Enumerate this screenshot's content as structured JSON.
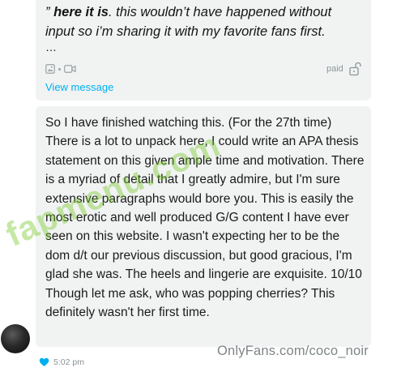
{
  "message_preview": {
    "quote_mark": "”",
    "bold_phrase": "here it is",
    "text": ". this wouldn’t have happened without input so i’m sharing it with my favorite fans first.",
    "ellipsis": "…",
    "media_icons": [
      "image-icon",
      "video-icon"
    ],
    "paid_label": "paid",
    "view_message_label": "View message"
  },
  "reply": {
    "text": "So I have finished watching this. (For the 27th time) There is a lot to unpack here, I could write an APA thesis statement on this given ample time and motivation. There is a myriad of detail that I greatly admire, but I'm sure extensive paragraphs would bore you. This is easily the most erotic and well produced G/G content I have ever seen on this website. I wasn't expecting her to be the dom d/t our previous discussion, but good gracious, I'm glad she was. The heels and lingerie are exquisite. 10/10 Though let me ask, who was popping cherries? This definitely wasn't her first time.",
    "timestamp": "5:02 pm"
  },
  "watermark": "OnlyFans.com/coco_noir",
  "overlay_watermark": "fapmenu.com",
  "colors": {
    "accent": "#00aff0",
    "bubble": "#f1f3f3",
    "muted": "#8c9698"
  }
}
